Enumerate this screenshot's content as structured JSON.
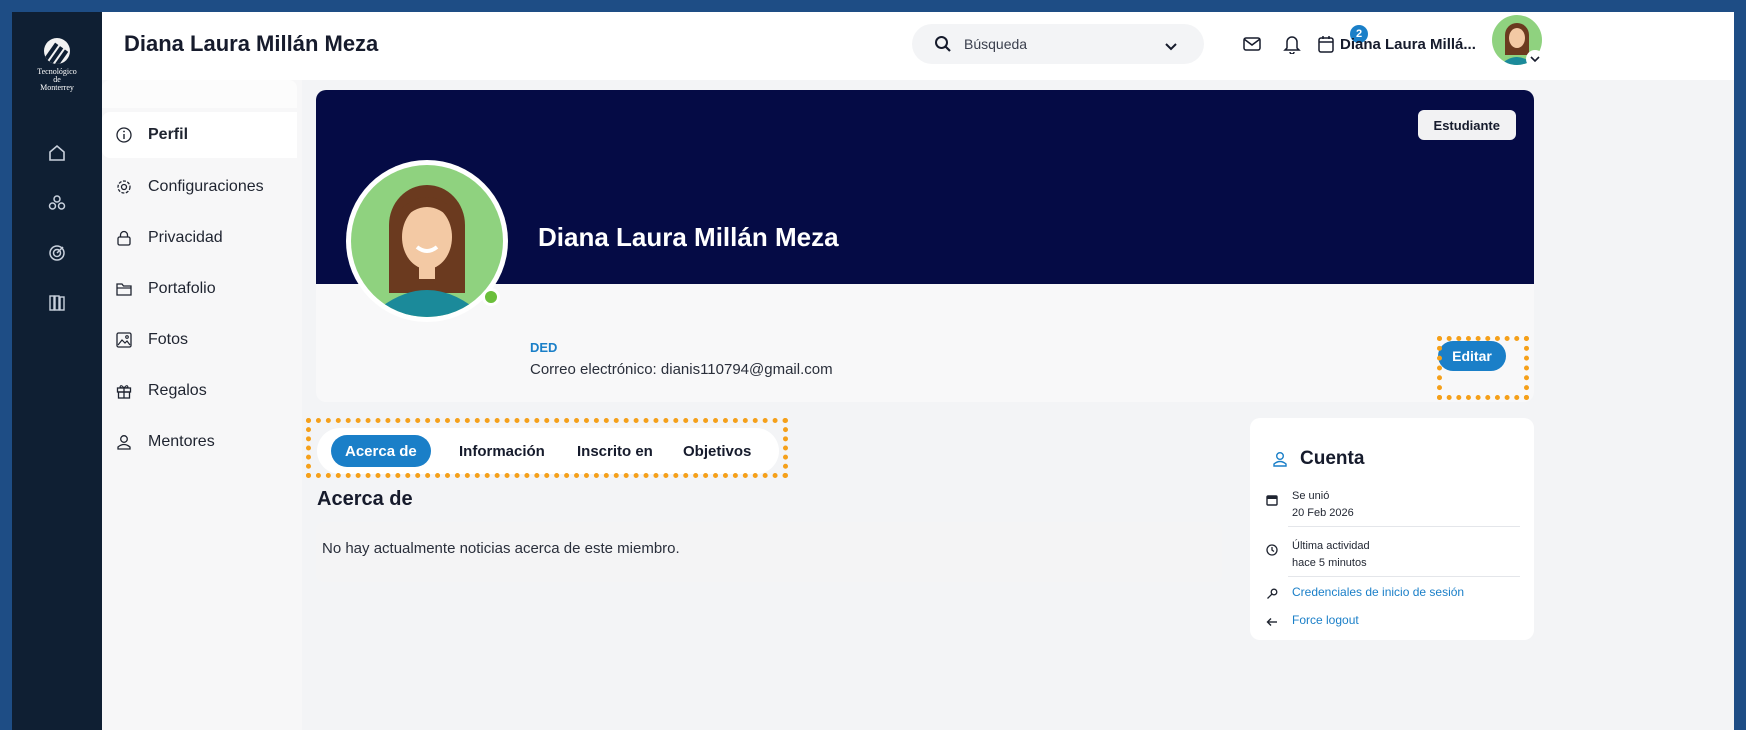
{
  "rail": {
    "brand": "Tecnológico de Monterrey",
    "icons": [
      "home-icon",
      "groups-icon",
      "target-icon",
      "library-icon"
    ]
  },
  "header": {
    "title": "Diana Laura Millán Meza",
    "search_placeholder": "Búsqueda",
    "notification_count": "2",
    "user_name": "Diana Laura Millá..."
  },
  "subnav": {
    "items": [
      {
        "label": "Perfil",
        "icon": "info-icon"
      },
      {
        "label": "Configuraciones",
        "icon": "gear-icon"
      },
      {
        "label": "Privacidad",
        "icon": "lock-icon"
      },
      {
        "label": "Portafolio",
        "icon": "folder-icon"
      },
      {
        "label": "Fotos",
        "icon": "image-icon"
      },
      {
        "label": "Regalos",
        "icon": "gift-icon"
      },
      {
        "label": "Mentores",
        "icon": "person-icon"
      }
    ]
  },
  "profile": {
    "role": "Estudiante",
    "name": "Diana Laura Millán Meza",
    "department": "DED",
    "email": "Correo electrónico: dianis110794@gmail.com",
    "edit_label": "Editar"
  },
  "tabs": [
    "Acerca de",
    "Información",
    "Inscrito en",
    "Objetivos"
  ],
  "about": {
    "title": "Acerca de",
    "text": "No hay actualmente noticias acerca de este miembro."
  },
  "account": {
    "title": "Cuenta",
    "joined_label": "Se unió",
    "joined_value": "20 Feb 2026",
    "activity_label": "Última actividad",
    "activity_value": "hace 5 minutos",
    "credentials_link": "Credenciales de inicio de sesión",
    "logout_link": "Force logout"
  },
  "colors": {
    "accent": "#1a7fc8",
    "banner": "#050b45",
    "highlight": "#f5a01a"
  }
}
